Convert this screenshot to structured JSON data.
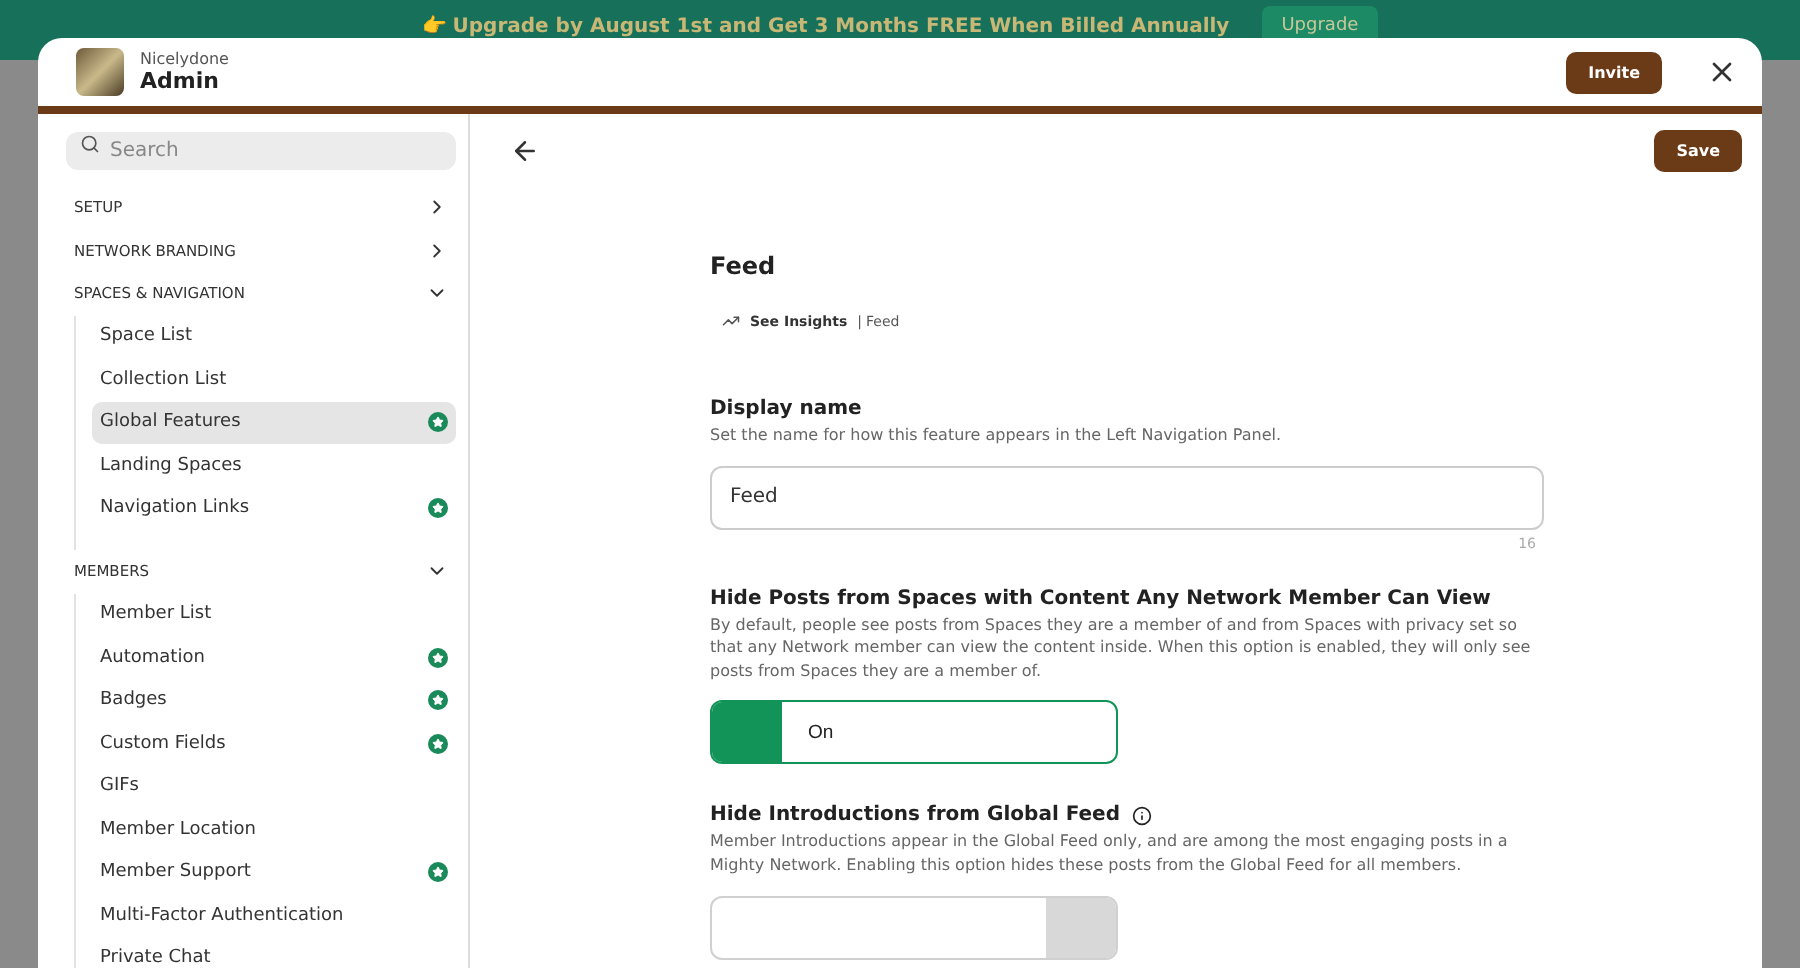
{
  "banner": {
    "text": "👉 Upgrade by August 1st and Get 3 Months FREE When Billed Annually",
    "button": "Upgrade"
  },
  "header": {
    "network": "Nicelydone",
    "title": "Admin",
    "invite": "Invite"
  },
  "sidebar": {
    "search": {
      "placeholder": "Search"
    },
    "sections": [
      {
        "label": "SETUP",
        "expanded": false
      },
      {
        "label": "NETWORK BRANDING",
        "expanded": false
      },
      {
        "label": "SPACES & NAVIGATION",
        "expanded": true,
        "items": [
          {
            "label": "Space List",
            "selected": false,
            "premium": false
          },
          {
            "label": "Collection List",
            "selected": false,
            "premium": false
          },
          {
            "label": "Global Features",
            "selected": true,
            "premium": true
          },
          {
            "label": "Landing Spaces",
            "selected": false,
            "premium": false
          },
          {
            "label": "Navigation Links",
            "selected": false,
            "premium": true
          }
        ]
      },
      {
        "label": "MEMBERS",
        "expanded": true,
        "items": [
          {
            "label": "Member List",
            "selected": false,
            "premium": false
          },
          {
            "label": "Automation",
            "selected": false,
            "premium": true
          },
          {
            "label": "Badges",
            "selected": false,
            "premium": true
          },
          {
            "label": "Custom Fields",
            "selected": false,
            "premium": true
          },
          {
            "label": "GIFs",
            "selected": false,
            "premium": false
          },
          {
            "label": "Member Location",
            "selected": false,
            "premium": false
          },
          {
            "label": "Member Support",
            "selected": false,
            "premium": true
          },
          {
            "label": "Multi-Factor Authentication",
            "selected": false,
            "premium": false
          },
          {
            "label": "Private Chat",
            "selected": false,
            "premium": false
          }
        ]
      }
    ]
  },
  "content": {
    "save": "Save",
    "title": "Feed",
    "insights": {
      "link": "See Insights",
      "separator": "|",
      "page": "Feed"
    },
    "display_name": {
      "label": "Display name",
      "description": "Set the name for how this feature appears in the Left Navigation Panel.",
      "value": "Feed",
      "count": "16"
    },
    "settings": [
      {
        "label": "Hide Posts from Spaces with Content Any Network Member Can View",
        "info": false,
        "description": "By default, people see posts from Spaces they are a member of and from Spaces with privacy set so that any Network member can view the content inside. When this option is enabled, they will only see posts from Spaces they are a member of.",
        "on": true,
        "state": "On"
      },
      {
        "label": "Hide Introductions from Global Feed",
        "info": true,
        "description": "Member Introductions appear in the Global Feed only, and are among the most engaging posts in a Mighty Network. Enabling this option hides these posts from the Global Feed for all members.",
        "on": false
      }
    ]
  }
}
